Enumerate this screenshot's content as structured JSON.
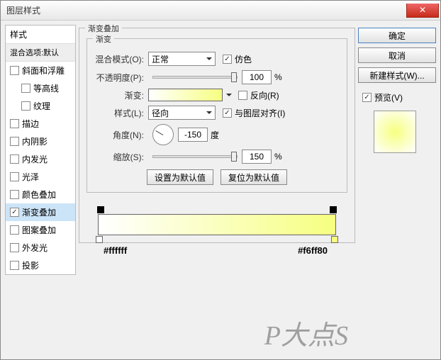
{
  "title": "图层样式",
  "left": {
    "header": "样式",
    "blend": "混合选项:默认",
    "items": [
      {
        "label": "斜面和浮雕",
        "checked": false,
        "indent": false
      },
      {
        "label": "等高线",
        "checked": false,
        "indent": true
      },
      {
        "label": "纹理",
        "checked": false,
        "indent": true
      },
      {
        "label": "描边",
        "checked": false,
        "indent": false
      },
      {
        "label": "内阴影",
        "checked": false,
        "indent": false
      },
      {
        "label": "内发光",
        "checked": false,
        "indent": false
      },
      {
        "label": "光泽",
        "checked": false,
        "indent": false
      },
      {
        "label": "颜色叠加",
        "checked": false,
        "indent": false
      },
      {
        "label": "渐变叠加",
        "checked": true,
        "indent": false,
        "selected": true
      },
      {
        "label": "图案叠加",
        "checked": false,
        "indent": false
      },
      {
        "label": "外发光",
        "checked": false,
        "indent": false
      },
      {
        "label": "投影",
        "checked": false,
        "indent": false
      }
    ]
  },
  "center": {
    "group_title": "渐变叠加",
    "inner_title": "渐变",
    "blend_mode_label": "混合模式(O):",
    "blend_mode_value": "正常",
    "dither_label": "仿色",
    "opacity_label": "不透明度(P):",
    "opacity_value": "100",
    "opacity_unit": "%",
    "gradient_label": "渐变:",
    "reverse_label": "反向(R)",
    "style_label": "样式(L):",
    "style_value": "径向",
    "align_label": "与图层对齐(I)",
    "angle_label": "角度(N):",
    "angle_value": "-150",
    "angle_unit": "度",
    "scale_label": "缩放(S):",
    "scale_value": "150",
    "scale_unit": "%",
    "btn_default": "设置为默认值",
    "btn_reset": "复位为默认值",
    "stop_left": "#ffffff",
    "stop_right": "#f6ff80"
  },
  "right": {
    "ok": "确定",
    "cancel": "取消",
    "new_style": "新建样式(W)...",
    "preview": "预览(V)"
  },
  "watermark": "P大点S"
}
